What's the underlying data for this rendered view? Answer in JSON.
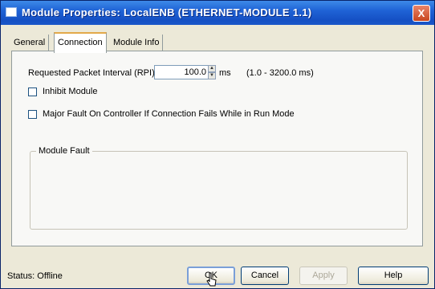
{
  "window": {
    "title": "Module Properties: LocalENB (ETHERNET-MODULE 1.1)",
    "close_label": "X"
  },
  "tabs": [
    {
      "label": "General"
    },
    {
      "label": "Connection"
    },
    {
      "label": "Module Info"
    }
  ],
  "connection": {
    "rpi_label": "Requested Packet Interval (RPI):",
    "rpi_value": "100.0",
    "rpi_unit": "ms",
    "rpi_range": "(1.0 - 3200.0 ms)",
    "inhibit_label": "Inhibit Module",
    "major_fault_label": "Major Fault On Controller If Connection Fails While in Run Mode",
    "module_fault_label": "Module Fault"
  },
  "status": {
    "text": "Status:  Offline"
  },
  "buttons": {
    "ok": "OK",
    "cancel": "Cancel",
    "apply": "Apply",
    "help": "Help"
  }
}
